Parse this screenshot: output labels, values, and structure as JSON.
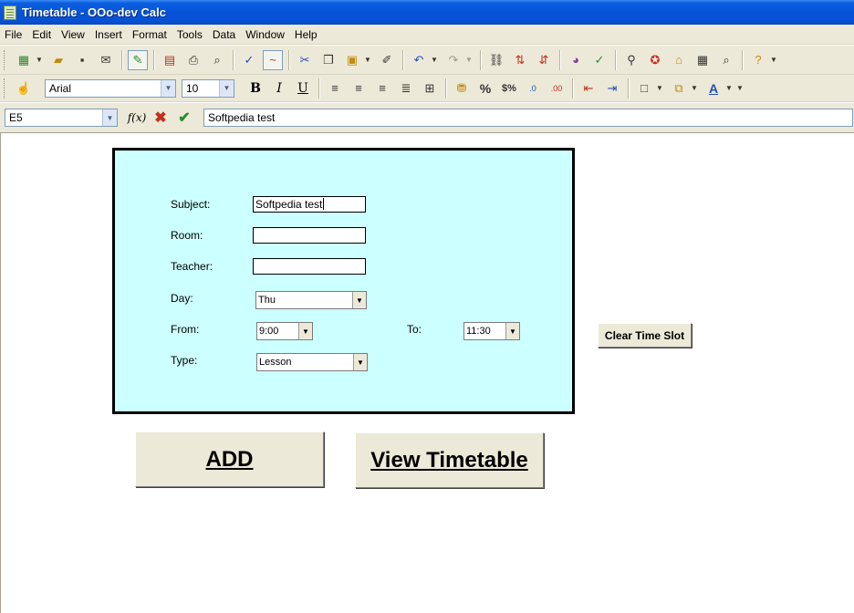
{
  "window": {
    "title": "Timetable - OOo-dev Calc"
  },
  "menu": [
    {
      "label": "File"
    },
    {
      "label": "Edit"
    },
    {
      "label": "View"
    },
    {
      "label": "Insert"
    },
    {
      "label": "Format"
    },
    {
      "label": "Tools"
    },
    {
      "label": "Data"
    },
    {
      "label": "Window"
    },
    {
      "label": "Help"
    }
  ],
  "format_toolbar": {
    "font_name": "Arial",
    "font_size": "10",
    "bold": "B",
    "italic": "I",
    "underline": "U",
    "percent": "%",
    "currency": "$%",
    "font_color_glyph": "A"
  },
  "formula_bar": {
    "cell_ref": "E5",
    "function_glyph": "f(x)",
    "content": "Softpedia test"
  },
  "form": {
    "subject_label": "Subject:",
    "subject_value": "Softpedia test",
    "room_label": "Room:",
    "room_value": "",
    "teacher_label": "Teacher:",
    "teacher_value": "",
    "day_label": "Day:",
    "day_value": "Thu",
    "from_label": "From:",
    "from_value": "9:00",
    "to_label": "To:",
    "to_value": "11:30",
    "type_label": "Type:",
    "type_value": "Lesson"
  },
  "buttons": {
    "clear": "Clear Time Slot",
    "add": "ADD",
    "view": "View Timetable"
  },
  "colors": {
    "panel_bg": "#ccffff",
    "titlebar": "#0753d8",
    "chrome": "#ece9d8"
  }
}
